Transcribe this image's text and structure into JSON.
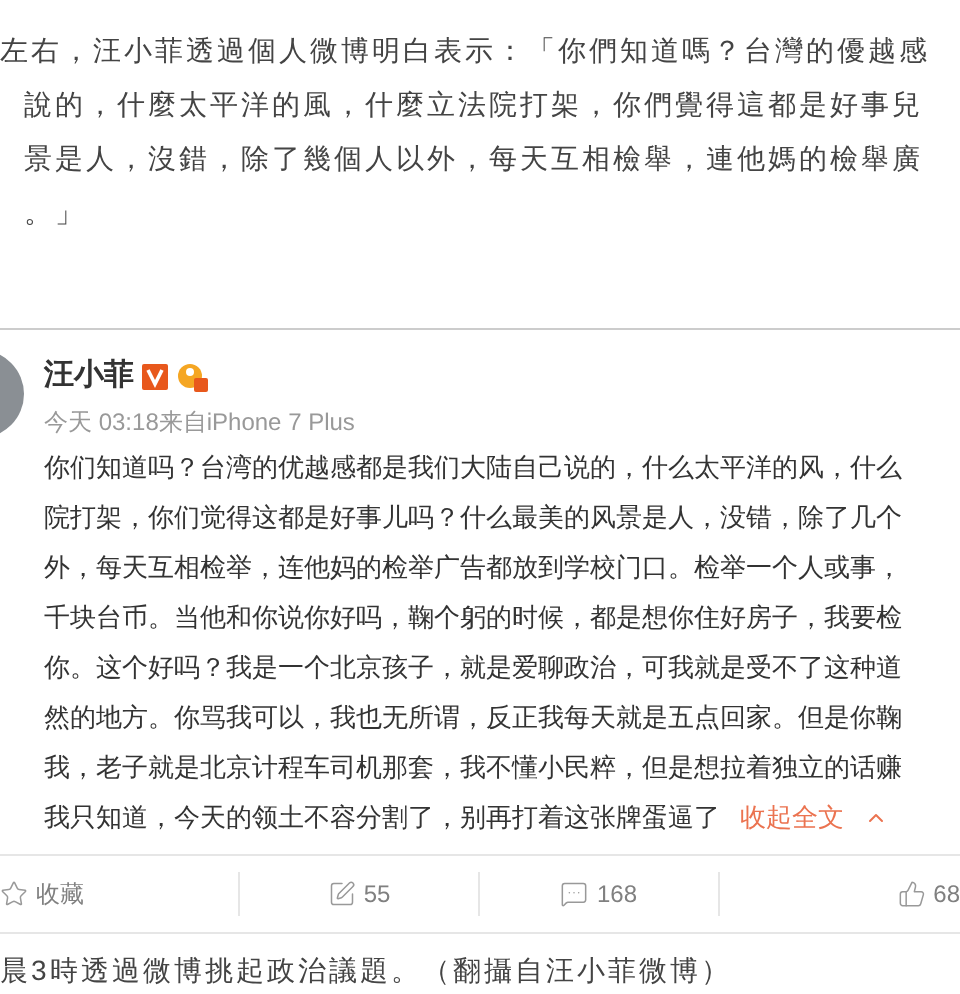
{
  "article": {
    "lines": [
      "左右，汪小菲透過個人微博明白表示：「你們知道嗎？台灣的優越感",
      "說的，什麼太平洋的風，什麼立法院打架，你們覺得這都是好事兒",
      "景是人，沒錯，除了幾個人以外，每天互相檢舉，連他媽的檢舉廣",
      "。」"
    ]
  },
  "post": {
    "author": "汪小菲",
    "meta": "今天 03:18来自iPhone 7 Plus",
    "lines": [
      "你们知道吗？台湾的优越感都是我们大陆自己说的，什么太平洋的风，什么",
      "院打架，你们觉得这都是好事儿吗？什么最美的风景是人，没错，除了几个",
      "外，每天互相检举，连他妈的检举广告都放到学校门口。检举一个人或事，",
      "千块台币。当他和你说你好吗，鞠个躬的时候，都是想你住好房子，我要检",
      "你。这个好吗？我是一个北京孩子，就是爱聊政治，可我就是受不了这种道",
      "然的地方。你骂我可以，我也无所谓，反正我每天就是五点回家。但是你鞠",
      "我，老子就是北京计程车司机那套，我不懂小民粹，但是想拉着独立的话赚",
      "我只知道，今天的领土不容分割了，别再打着这张牌蛋逼了"
    ],
    "collapse_link": "收起全文"
  },
  "actions": [
    {
      "kind": "favorite",
      "label": "收藏"
    },
    {
      "kind": "repost",
      "label": "55"
    },
    {
      "kind": "comment",
      "label": "168"
    },
    {
      "kind": "like",
      "label": "68"
    }
  ],
  "caption": "晨3時透過微博挑起政治議題。（翻攝自汪小菲微博）"
}
